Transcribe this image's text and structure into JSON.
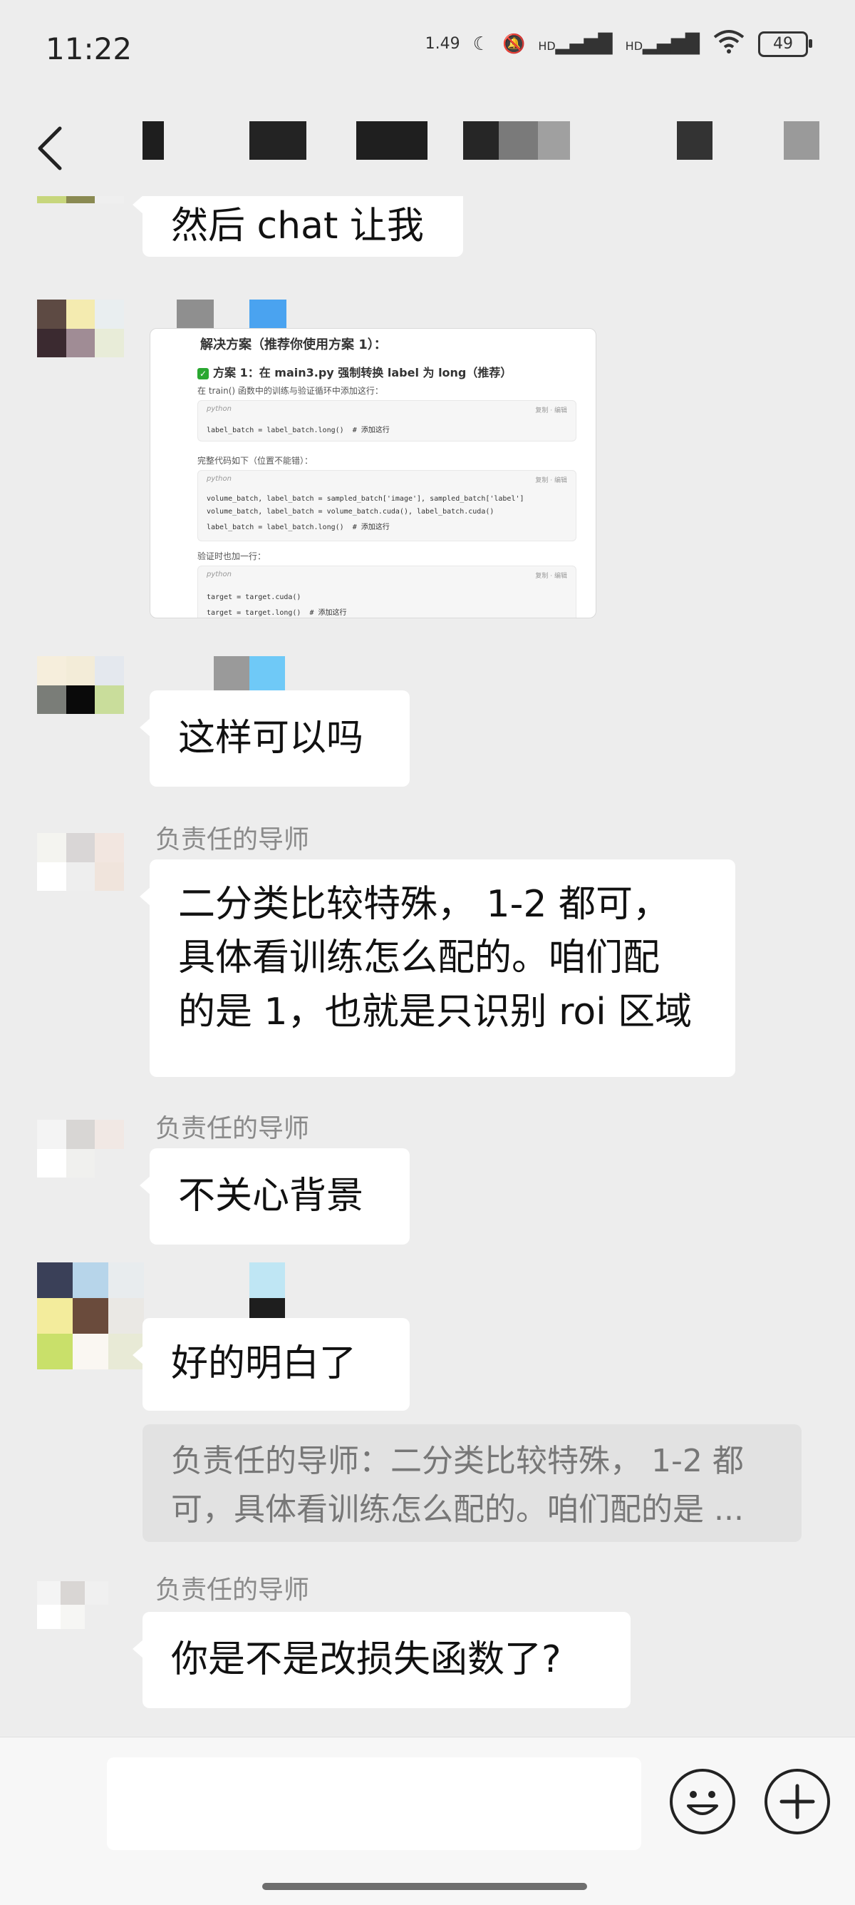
{
  "status_bar": {
    "time": "11:22",
    "network_speed": "1.49",
    "signal_label_1": "HD",
    "signal_label_2": "HD",
    "battery_level": "49"
  },
  "header": {
    "back_icon": "chevron-left-icon"
  },
  "messages": [
    {
      "type": "text",
      "sender": "self",
      "text": "然后 chat 让我"
    },
    {
      "type": "image",
      "sender": "self",
      "image": {
        "title": "解决方案（推荐你使用方案 1）：",
        "subtitle": "方案 1：在 main3.py 强制转换 label 为 long（推荐）",
        "line1": "在 train() 函数中的训练与验证循环中添加这行：",
        "code1_lang": "python",
        "code1_line": "label_batch = label_batch.long()  # 添加这行",
        "line2": "完整代码如下（位置不能错）：",
        "code2_lang": "python",
        "code2_lines": [
          "volume_batch, label_batch = sampled_batch['image'], sampled_batch['label']",
          "volume_batch, label_batch = volume_batch.cuda(), label_batch.cuda()",
          "label_batch = label_batch.long()  # 添加这行"
        ],
        "line3": "验证时也加一行：",
        "code3_lang": "python",
        "code3_lines": [
          "target = target.cuda()",
          "target = target.long()  # 添加这行"
        ],
        "copy_label": "复制",
        "edit_label": "编辑"
      }
    },
    {
      "type": "text",
      "sender": "self",
      "text": "这样可以吗"
    },
    {
      "type": "text",
      "sender": "other",
      "name": "负责任的导师",
      "lines": [
        "二分类比较特殊， 1-2 都可，",
        "具体看训练怎么配的。咱们配",
        "的是 1，也就是只识别 roi 区域"
      ]
    },
    {
      "type": "text",
      "sender": "other",
      "name": "负责任的导师",
      "text": "不关心背景"
    },
    {
      "type": "text",
      "sender": "self",
      "text": "好的明白了",
      "quote_lines": [
        "负责任的导师：二分类比较特殊， 1-2 都",
        "可，具体看训练怎么配的。咱们配的是 ..."
      ]
    },
    {
      "type": "text",
      "sender": "other",
      "name": "负责任的导师",
      "text": "你是不是改损失函数了?"
    }
  ],
  "input_bar": {
    "emoji_icon": "emoji-icon",
    "plus_icon": "plus-icon"
  }
}
